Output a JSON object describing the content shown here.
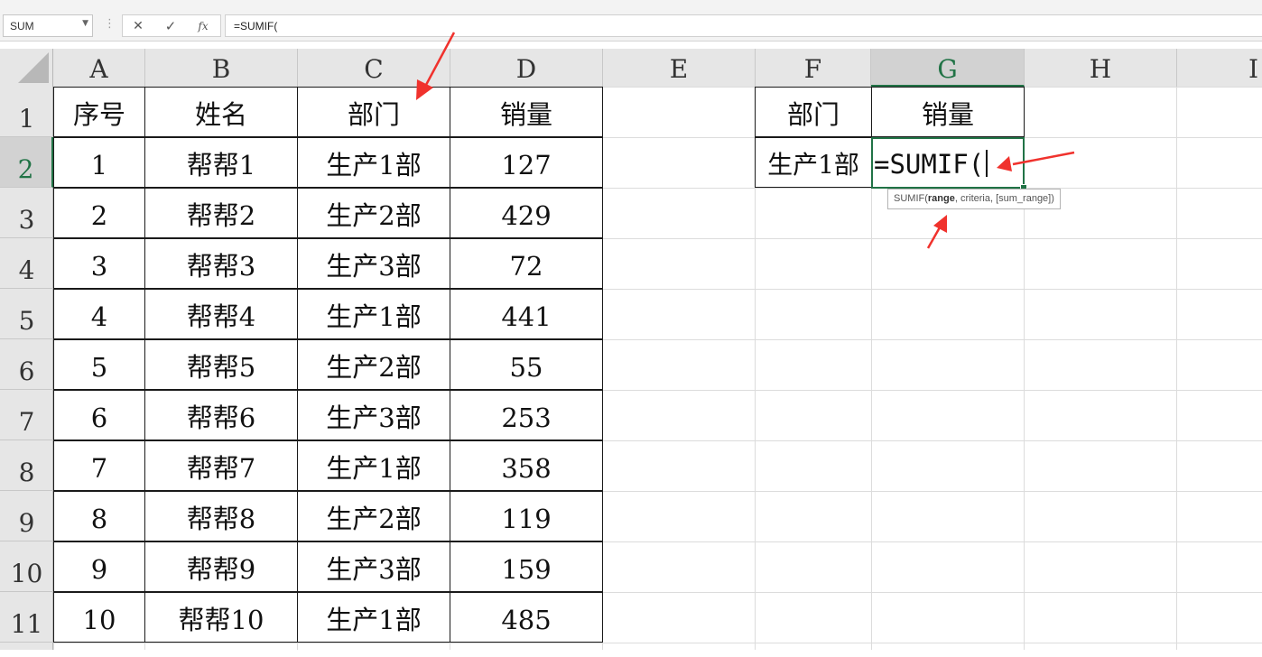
{
  "formula_bar": {
    "name_box": "SUM",
    "cancel_icon": "✕",
    "enter_icon": "✓",
    "function_icon": "fx",
    "formula": "=SUMIF("
  },
  "columns": [
    "A",
    "B",
    "C",
    "D",
    "E",
    "F",
    "G",
    "H",
    "I"
  ],
  "rows": [
    "1",
    "2",
    "3",
    "4",
    "5",
    "6",
    "7",
    "8",
    "9",
    "10",
    "11"
  ],
  "table": {
    "headers": [
      "序号",
      "姓名",
      "部门",
      "销量"
    ],
    "rows": [
      [
        "1",
        "帮帮1",
        "生产1部",
        "127"
      ],
      [
        "2",
        "帮帮2",
        "生产2部",
        "429"
      ],
      [
        "3",
        "帮帮3",
        "生产3部",
        "72"
      ],
      [
        "4",
        "帮帮4",
        "生产1部",
        "441"
      ],
      [
        "5",
        "帮帮5",
        "生产2部",
        "55"
      ],
      [
        "6",
        "帮帮6",
        "生产3部",
        "253"
      ],
      [
        "7",
        "帮帮7",
        "生产1部",
        "358"
      ],
      [
        "8",
        "帮帮8",
        "生产2部",
        "119"
      ],
      [
        "9",
        "帮帮9",
        "生产3部",
        "159"
      ],
      [
        "10",
        "帮帮10",
        "生产1部",
        "485"
      ]
    ]
  },
  "summary": {
    "header_dept": "部门",
    "header_sales": "销量",
    "dept_value": "生产1部",
    "editing_formula": "=SUMIF("
  },
  "tooltip": {
    "func": "SUMIF(",
    "arg_range": "range",
    "rest": ", criteria, [sum_range])"
  },
  "selected": {
    "column": "G",
    "row": "2"
  },
  "colors": {
    "accent": "#217346",
    "arrow": "#f0322d"
  }
}
